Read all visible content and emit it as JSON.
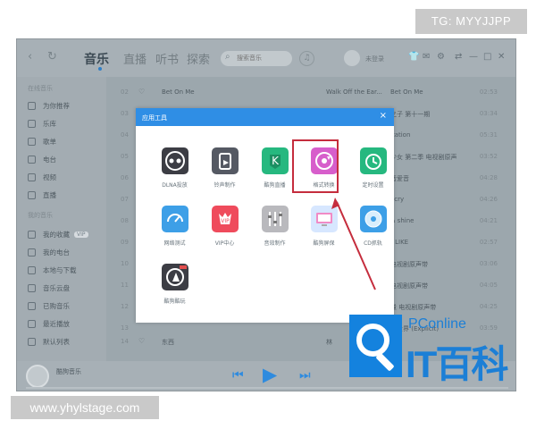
{
  "watermark": {
    "top": "TG: MYYJJPP",
    "bottom": "www.yhylstage.com"
  },
  "nav": {
    "back_icon": "back-icon",
    "refresh_icon": "refresh-icon",
    "tabs": [
      {
        "label": "音乐",
        "active": true
      },
      {
        "label": "直播",
        "active": false
      },
      {
        "label": "听书",
        "active": false
      },
      {
        "label": "探索",
        "active": false
      }
    ],
    "search": {
      "placeholder": "搜索音乐"
    },
    "user_label": "未登录"
  },
  "sidebar": {
    "sections": [
      {
        "heading": "在线音乐",
        "items": [
          "为你推荐",
          "乐库",
          "歌单",
          "电台",
          "视频",
          "直播"
        ]
      },
      {
        "heading": "我的音乐",
        "items": [
          "我的收藏",
          "我的电台",
          "本地与下载",
          "音乐云盘",
          "已购音乐",
          "最近播放",
          "默认列表"
        ]
      }
    ],
    "favorite_badge": "VIP"
  },
  "tracks": [
    {
      "idx": "02",
      "title": "Bet On Me",
      "artist": "Walk Off the Ear...",
      "album": "Bet On Me",
      "duration": "02:53"
    },
    {
      "idx": "03",
      "title": "",
      "artist": "",
      "album": "之子 第十一期",
      "duration": "03:34"
    },
    {
      "idx": "04",
      "title": "",
      "artist": "",
      "album": "itation",
      "duration": "05:31"
    },
    {
      "idx": "05",
      "title": "",
      "artist": "",
      "album": "少女 第二季 电视剧原声",
      "duration": "03:52"
    },
    {
      "idx": "06",
      "title": "",
      "artist": "",
      "album": "音爱音",
      "duration": "04:28"
    },
    {
      "idx": "07",
      "title": "",
      "artist": "",
      "album": "ecry",
      "duration": "04:26"
    },
    {
      "idx": "08",
      "title": "",
      "artist": "",
      "album": "& shine",
      "duration": "04:21"
    },
    {
      "idx": "09",
      "title": "",
      "artist": "",
      "album": "r LIKE",
      "duration": "02:57"
    },
    {
      "idx": "10",
      "title": "",
      "artist": "",
      "album": "电视剧原声带",
      "duration": "03:06"
    },
    {
      "idx": "11",
      "title": "",
      "artist": "",
      "album": "电视剧原声带",
      "duration": "04:05"
    },
    {
      "idx": "12",
      "title": "",
      "artist": "",
      "album": "量 电视剧原声带",
      "duration": "04:25"
    },
    {
      "idx": "13",
      "title": "",
      "artist": "",
      "album": "乐世界 (Explicit)",
      "duration": "03:59"
    },
    {
      "idx": "14",
      "title": "东西",
      "artist": "林",
      "album": "",
      "duration": ""
    }
  ],
  "player": {
    "now_playing": "酷狗音乐"
  },
  "dialog": {
    "title": "应用工具",
    "close": "×",
    "tools": [
      {
        "label": "DLNA投放",
        "icon": "dlna-icon",
        "color": "#3c3d44"
      },
      {
        "label": "铃声制作",
        "icon": "ringtone-maker-icon",
        "color": "#555963"
      },
      {
        "label": "酷狗直播",
        "icon": "kugou-live-icon",
        "color": "#26b87f"
      },
      {
        "label": "格式转换",
        "icon": "format-converter-icon",
        "color": "#d75ecb"
      },
      {
        "label": "定时设置",
        "icon": "timer-icon",
        "color": "#26b87f"
      },
      {
        "label": "网络测试",
        "icon": "network-test-icon",
        "color": "#3d9fe7"
      },
      {
        "label": "VIP中心",
        "icon": "vip-center-icon",
        "color": "#ef4b5c"
      },
      {
        "label": "音效制作",
        "icon": "sound-effect-icon",
        "color": "#b9b9bd"
      },
      {
        "label": "酷狗屏保",
        "icon": "screensaver-icon",
        "color": "#d7e7ff"
      },
      {
        "label": "CD抓轨",
        "icon": "cd-ripper-icon",
        "color": "#3d9fe7"
      },
      {
        "label": "酷狗酷玩",
        "icon": "kugou-play-icon",
        "color": "#3c3d44"
      }
    ]
  },
  "badge": {
    "top_text": "PConline",
    "name": "IT百科"
  }
}
